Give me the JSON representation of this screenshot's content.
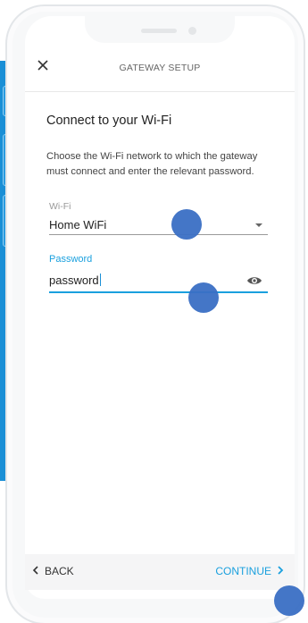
{
  "header": {
    "title": "GATEWAY SETUP",
    "close_icon": "close-icon"
  },
  "content": {
    "title": "Connect to your Wi-Fi",
    "description": "Choose the Wi-Fi network to which the gateway must connect and enter the relevant password."
  },
  "wifi": {
    "label": "Wi-Fi",
    "value": "Home WiFi",
    "icon": "dropdown-arrow-icon"
  },
  "password": {
    "label": "Password",
    "value": "password",
    "icon": "eye-icon"
  },
  "footer": {
    "back_label": "BACK",
    "continue_label": "CONTINUE",
    "back_icon": "chevron-left-icon",
    "continue_icon": "chevron-right-icon"
  },
  "colors": {
    "accent": "#1aa0de",
    "touch_dot": "#3a6fc4",
    "side_strip": "#1a8fd6"
  }
}
